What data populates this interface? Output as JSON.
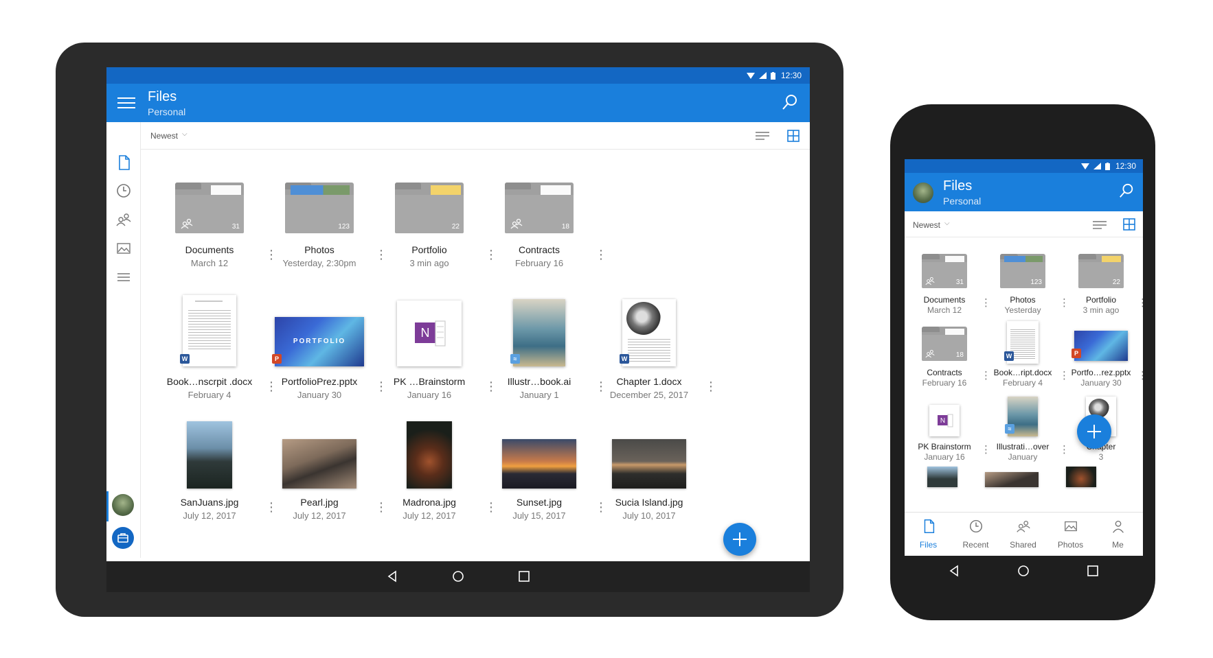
{
  "tablet": {
    "status": {
      "time": "12:30"
    },
    "appbar": {
      "title": "Files",
      "subtitle": "Personal"
    },
    "sort": {
      "label": "Newest"
    },
    "items": [
      {
        "name": "Documents",
        "date": "March 12",
        "kind": "folder",
        "count": "31",
        "shared": true
      },
      {
        "name": "Photos",
        "date": "Yesterday, 2:30pm",
        "kind": "folder",
        "count": "123",
        "shared": false
      },
      {
        "name": "Portfolio",
        "date": "3 min ago",
        "kind": "folder",
        "count": "22",
        "shared": false
      },
      {
        "name": "Contracts",
        "date": "February 16",
        "kind": "folder",
        "count": "18",
        "shared": true
      },
      {
        "name": "Book…nscrpit .docx",
        "date": "February 4",
        "kind": "word"
      },
      {
        "name": "PortfolioPrez.pptx",
        "date": "January 30",
        "kind": "pptx",
        "thumb_text": "PORTFOLIO"
      },
      {
        "name": "PK …Brainstorm",
        "date": "January 16",
        "kind": "onenote"
      },
      {
        "name": "Illustr…book.ai",
        "date": "January 1",
        "kind": "ai"
      },
      {
        "name": "Chapter 1.docx",
        "date": "December 25, 2017",
        "kind": "word"
      },
      {
        "name": "SanJuans.jpg",
        "date": "July 12, 2017",
        "kind": "photo"
      },
      {
        "name": "Pearl.jpg",
        "date": "July 12, 2017",
        "kind": "photo"
      },
      {
        "name": "Madrona.jpg",
        "date": "July 12, 2017",
        "kind": "photo"
      },
      {
        "name": "Sunset.jpg",
        "date": "July 15, 2017",
        "kind": "photo"
      },
      {
        "name": "Sucia Island.jpg",
        "date": "July 10, 2017",
        "kind": "photo"
      }
    ]
  },
  "phone": {
    "status": {
      "time": "12:30"
    },
    "appbar": {
      "title": "Files",
      "subtitle": "Personal"
    },
    "sort": {
      "label": "Newest"
    },
    "items": [
      {
        "name": "Documents",
        "date": "March 12",
        "count": "31"
      },
      {
        "name": "Photos",
        "date": "Yesterday",
        "count": "123"
      },
      {
        "name": "Portfolio",
        "date": "3 min ago",
        "count": "22"
      },
      {
        "name": "Contracts",
        "date": "February 16",
        "count": "18"
      },
      {
        "name": "Book…ript.docx",
        "date": "February 4"
      },
      {
        "name": "Portfo…rez.pptx",
        "date": "January 30"
      },
      {
        "name": "PK Brainstorm",
        "date": "January 16"
      },
      {
        "name": "Illustrati…over",
        "date": "January"
      },
      {
        "name": "Chapter",
        "date": "3"
      }
    ],
    "tabs": [
      {
        "label": "Files",
        "icon": "file-icon",
        "active": true
      },
      {
        "label": "Recent",
        "icon": "clock-icon"
      },
      {
        "label": "Shared",
        "icon": "people-icon"
      },
      {
        "label": "Photos",
        "icon": "image-icon"
      },
      {
        "label": "Me",
        "icon": "person-icon"
      }
    ]
  },
  "colors": {
    "accent": "#1a7fdc",
    "status_bar": "#1367c3",
    "device": "#2b2b2b",
    "folder": "#a0a0a0"
  }
}
